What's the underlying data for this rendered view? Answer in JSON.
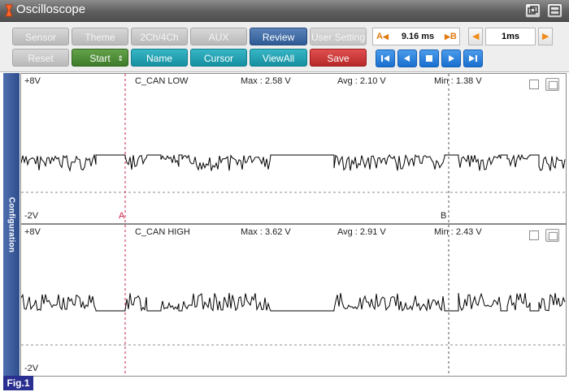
{
  "window": {
    "title": "Oscilloscope"
  },
  "toolbar": {
    "row1": [
      "Sensor",
      "Theme",
      "2Ch/4Ch",
      "AUX",
      "Review",
      "User Setting"
    ],
    "row2": {
      "reset": "Reset",
      "start": "Start",
      "name": "Name",
      "cursor": "Cursor",
      "viewall": "ViewAll",
      "save": "Save"
    },
    "cursor_delta": {
      "a_label": "A",
      "value": "9.16 ms",
      "b_label": "B"
    },
    "timebase": {
      "value": "1ms"
    }
  },
  "side_tab": {
    "label": "Configuration"
  },
  "channels": [
    {
      "name": "C_CAN LOW",
      "vmax_label": "+8V",
      "vmin_label": "-2V",
      "max": "Max : 2.58 V",
      "avg": "Avg : 2.10 V",
      "min": "Min : 1.38 V",
      "high_v": 2.5,
      "low_v": 1.5
    },
    {
      "name": "C_CAN HIGH",
      "vmax_label": "+8V",
      "vmin_label": "-2V",
      "max": "Max : 3.62 V",
      "avg": "Avg : 2.91 V",
      "min": "Min : 2.43 V",
      "high_v": 3.5,
      "low_v": 2.5
    }
  ],
  "cursors": {
    "a": "A",
    "b": "B"
  },
  "figure": {
    "label": "Fig.1"
  },
  "colors": {
    "active_blue": "#2f5b96",
    "start_green": "#3f7c2a",
    "teal": "#178f9f",
    "save_red": "#b72828",
    "cursor_red": "#cc2244",
    "trace": "#000000"
  }
}
